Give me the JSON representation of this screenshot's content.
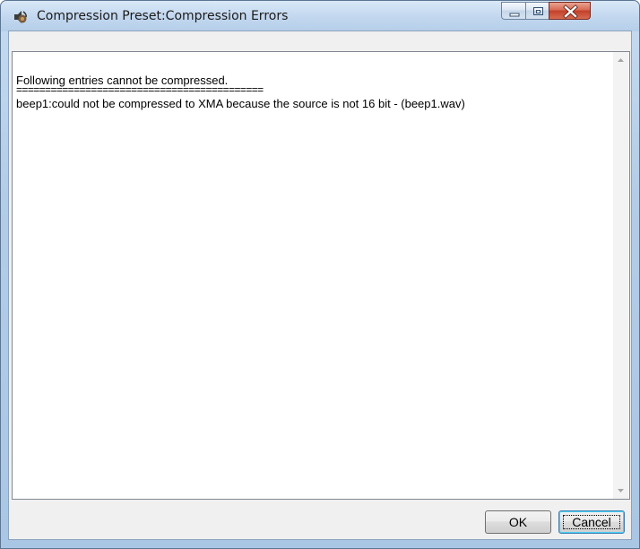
{
  "window": {
    "title": "Compression Preset:Compression Errors",
    "app_icon": "sound-app-icon",
    "controls": {
      "minimize_icon": "minimize-icon",
      "maximize_icon": "maximize-icon",
      "close_icon": "close-icon"
    }
  },
  "log": {
    "lines": [
      "Following entries cannot be compressed.",
      "===========================================",
      "beep1:could not be compressed to XMA because the source is not 16 bit - (beep1.wav)"
    ]
  },
  "buttons": {
    "ok_label": "OK",
    "cancel_label": "Cancel"
  },
  "colors": {
    "title_bar": "#c3d8ef",
    "close_button": "#c2402a",
    "dialog_face": "#f0f0f0",
    "textbox_border": "#828790"
  }
}
